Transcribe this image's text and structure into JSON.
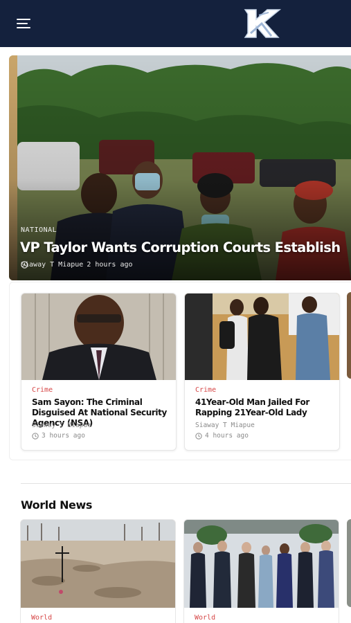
{
  "header": {
    "menu_icon": "hamburger-menu-icon",
    "logo_icon": "k-logo-icon",
    "colors": {
      "bar": "#14213d",
      "logo": "#ffffff"
    }
  },
  "hero": {
    "category": "NATIONAL",
    "title": "VP Taylor Wants Corruption Courts Establish",
    "author": "Siaway T Miapue",
    "time": "2 hours ago"
  },
  "featured": [
    {
      "category": "Crime",
      "title": "Sam Sayon: The Criminal Disguised At National Security Agency (NSA)",
      "author": "Siaway T Miapue",
      "time": "3 hours ago"
    },
    {
      "category": "Crime",
      "title": "41Year-Old Man Jailed For Rapping 21Year-Old Lady",
      "author": "Siaway T Miapue",
      "time": "4 hours ago"
    }
  ],
  "world_news": {
    "title": "World News",
    "items": [
      {
        "category": "World"
      },
      {
        "category": "World"
      }
    ]
  },
  "accent_colors": {
    "category_text": "#d64545"
  }
}
